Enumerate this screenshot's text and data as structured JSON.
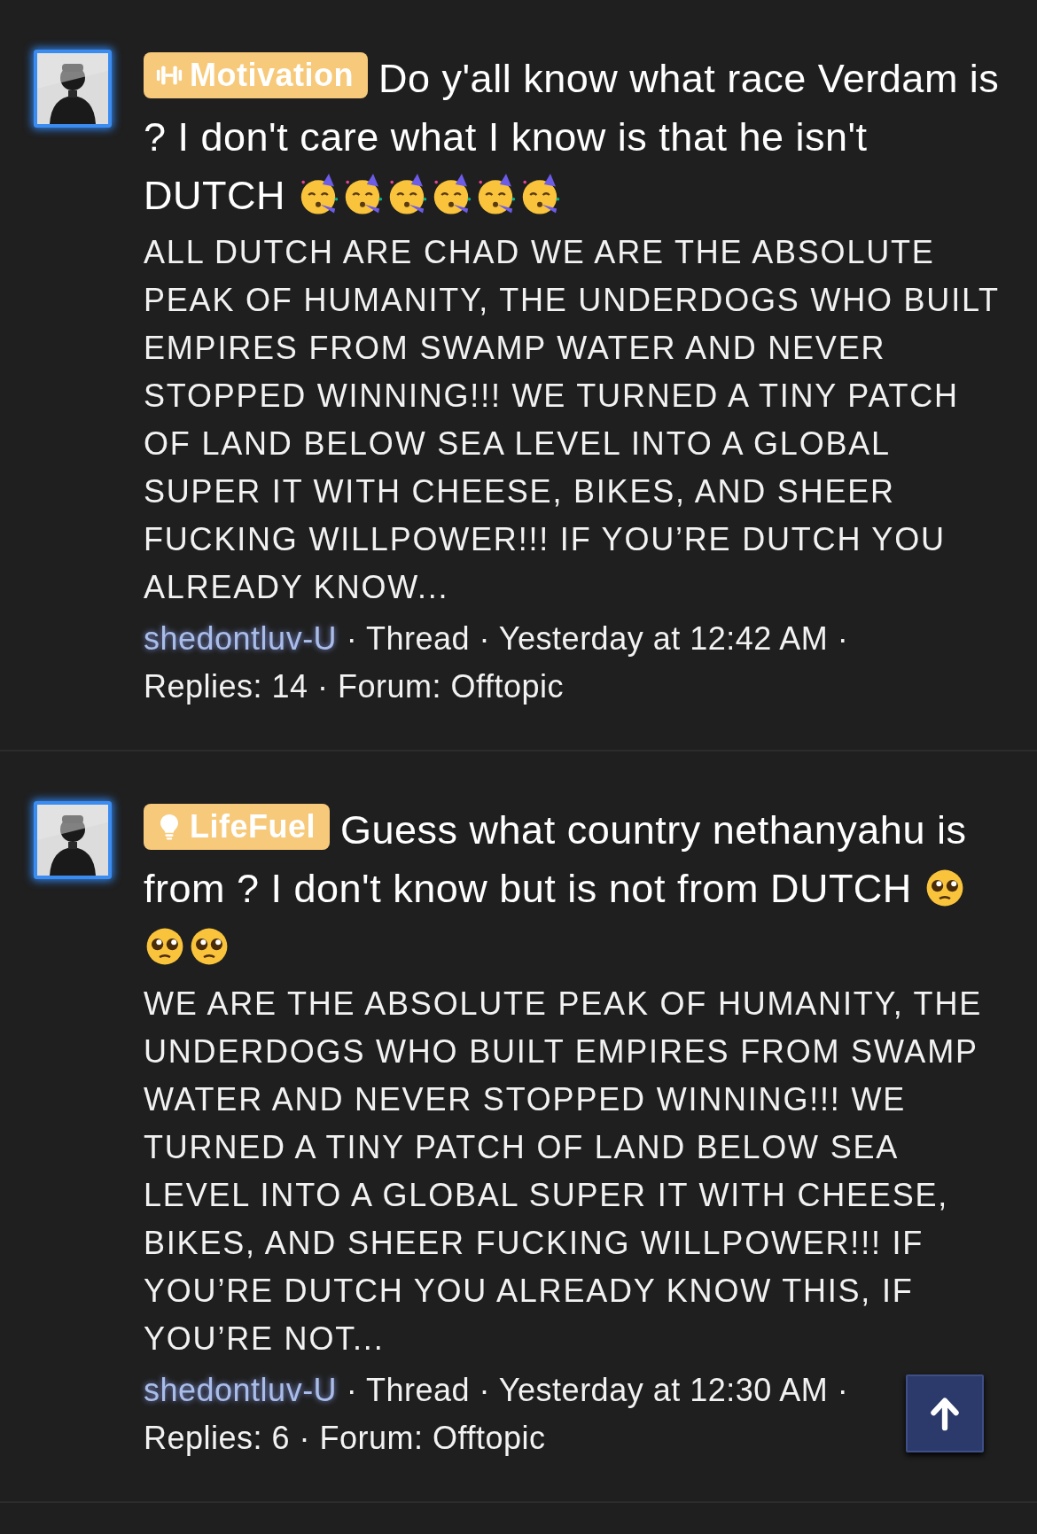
{
  "posts": [
    {
      "prefix": {
        "label": "Motivation",
        "kind": "dumbbell"
      },
      "title": "Do y'all know what race Verdam is ? I don't care what I know is that he isn't DUTCH",
      "emojis": [
        {
          "kind": "party"
        },
        {
          "kind": "party"
        },
        {
          "kind": "party"
        },
        {
          "kind": "party"
        },
        {
          "kind": "party"
        },
        {
          "kind": "party"
        }
      ],
      "snippet": "ALL DUTCH ARE CHAD WE ARE THE ABSOLUTE PEAK OF HUMANITY, THE UNDERDOGS WHO BUILT EMPIRES FROM SWAMP WATER AND NEVER STOPPED WINNING!!! WE TURNED A TINY PATCH OF LAND BELOW SEA LEVEL INTO A GLOBAL SUPER IT WITH CHEESE, BIKES, AND SHEER FUCKING WILLPOWER!!! IF YOU’RE DUTCH YOU ALREADY KNOW...",
      "author": "shedontluv-U",
      "meta": "· Thread · Yesterday at 12:42 AM · Replies: 14 · Forum: Offtopic"
    },
    {
      "prefix": {
        "label": "LifeFuel",
        "kind": "bulb"
      },
      "title": "Guess what country nethanyahu is from ? I don't know but is not from DUTCH",
      "emojis": [
        {
          "kind": "pleading"
        },
        {
          "kind": "pleading"
        },
        {
          "kind": "pleading"
        }
      ],
      "snippet": "WE ARE THE ABSOLUTE PEAK OF HUMANITY, THE UNDERDOGS WHO BUILT EMPIRES FROM SWAMP WATER AND NEVER STOPPED WINNING!!! WE TURNED A TINY PATCH OF LAND BELOW SEA LEVEL INTO A GLOBAL SUPER IT WITH CHEESE, BIKES, AND SHEER FUCKING WILLPOWER!!! IF YOU’RE DUTCH YOU ALREADY KNOW THIS, IF YOU’RE NOT...",
      "author": "shedontluv-U",
      "meta": "· Thread · Yesterday at 12:30 AM · Replies: 6 · Forum: Offtopic"
    }
  ]
}
